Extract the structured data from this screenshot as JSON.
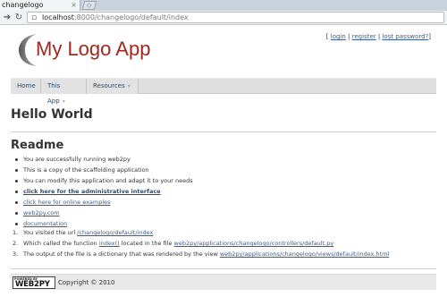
{
  "browser": {
    "tab_title": "changelogo",
    "tab_close": "×",
    "new_tab": "◇",
    "url_host": "localhost",
    "url_path": ":8000/changelogo/default/index"
  },
  "header": {
    "logo_text": "My Logo App",
    "auth": {
      "open": "[",
      "login": "login",
      "sep1": "|",
      "register": "register",
      "sep2": "|",
      "lost_password": "lost password?",
      "close": "]"
    }
  },
  "menu": [
    {
      "label": "Home",
      "has_arrow": false
    },
    {
      "label": "This App",
      "has_arrow": true
    },
    {
      "label": "Resources",
      "has_arrow": true
    }
  ],
  "main": {
    "title": "Hello World",
    "readme_heading": "Readme",
    "bullets": [
      {
        "text": "You are successfully running web2py"
      },
      {
        "text": "This is a copy of the scaffolding application"
      },
      {
        "text": "You can modify this application and adapt it to your needs"
      },
      {
        "link": "click here for the administrative interface",
        "bold": true
      },
      {
        "link": "click here for online examples"
      },
      {
        "link": "web2py.com"
      },
      {
        "link": "documentation"
      }
    ],
    "numbered": [
      {
        "num": "1.",
        "before": "You visited the url ",
        "link": "/changelogo/default/index",
        "after": ""
      },
      {
        "num": "2.",
        "before": "Which called the function ",
        "link": "index()",
        "mid": " located in the file ",
        "link2": "web2py/applications/changelogo/controllers/default.py"
      },
      {
        "num": "3.",
        "before": "The output of the file is a dictionary that was rendered by the view ",
        "link": "web2py/applications/changelogo/views/default/index.html"
      }
    ]
  },
  "footer": {
    "badge_top": "POWERED BY",
    "badge_main": "WEB2PY",
    "copyright": "Copyright © 2010"
  },
  "colors": {
    "logo_red": "#a2271e",
    "link_blue": "#3b5e8c"
  }
}
